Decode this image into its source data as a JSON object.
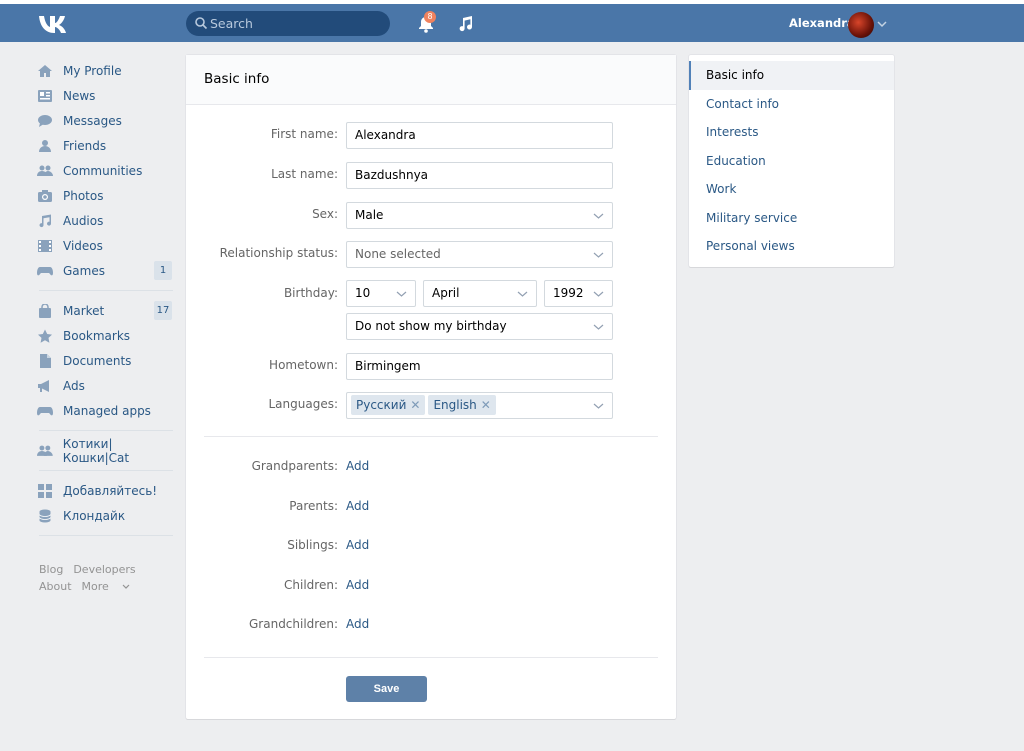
{
  "header": {
    "search_placeholder": "Search",
    "notifications_count": "8",
    "username": "Alexandra"
  },
  "nav": {
    "items": [
      {
        "label": "My Profile",
        "icon": "home-icon"
      },
      {
        "label": "News",
        "icon": "news-icon"
      },
      {
        "label": "Messages",
        "icon": "messages-icon"
      },
      {
        "label": "Friends",
        "icon": "friends-icon"
      },
      {
        "label": "Communities",
        "icon": "communities-icon"
      },
      {
        "label": "Photos",
        "icon": "camera-icon"
      },
      {
        "label": "Audios",
        "icon": "music-icon"
      },
      {
        "label": "Videos",
        "icon": "film-icon"
      },
      {
        "label": "Games",
        "icon": "gamepad-icon",
        "count": "1"
      }
    ],
    "items2": [
      {
        "label": "Market",
        "icon": "bag-icon",
        "count": "17"
      },
      {
        "label": "Bookmarks",
        "icon": "star-icon"
      },
      {
        "label": "Documents",
        "icon": "document-icon"
      },
      {
        "label": "Ads",
        "icon": "megaphone-icon"
      },
      {
        "label": "Managed apps",
        "icon": "gamepad-icon"
      }
    ],
    "items3": [
      {
        "label": "Котики|Кошки|Cat",
        "icon": "group-icon"
      }
    ],
    "items4": [
      {
        "label": "Добавляйтесь!",
        "icon": "grid-icon"
      },
      {
        "label": "Клондайк",
        "icon": "database-icon"
      }
    ],
    "footer": {
      "blog": "Blog",
      "developers": "Developers",
      "about": "About",
      "more": "More"
    }
  },
  "card": {
    "title": "Basic info",
    "first_name_label": "First name:",
    "first_name_value": "Alexandra",
    "last_name_label": "Last name:",
    "last_name_value": "Bazdushnya",
    "sex_label": "Sex:",
    "sex_value": "Male",
    "relationship_label": "Relationship status:",
    "relationship_value": "None selected",
    "birthday_label": "Birthday:",
    "birthday_day": "10",
    "birthday_month": "April",
    "birthday_year": "1992",
    "birthday_visibility": "Do not show my birthday",
    "hometown_label": "Hometown:",
    "hometown_value": "Birmingem",
    "languages_label": "Languages:",
    "languages": [
      "Русский",
      "English"
    ],
    "relatives": [
      {
        "label": "Grandparents:",
        "action": "Add"
      },
      {
        "label": "Parents:",
        "action": "Add"
      },
      {
        "label": "Siblings:",
        "action": "Add"
      },
      {
        "label": "Children:",
        "action": "Add"
      },
      {
        "label": "Grandchildren:",
        "action": "Add"
      }
    ],
    "save_label": "Save"
  },
  "right_menu": {
    "items": [
      "Basic info",
      "Contact info",
      "Interests",
      "Education",
      "Work",
      "Military service",
      "Personal views"
    ],
    "active": "Basic info"
  },
  "colors": {
    "header_bg": "#4a76a8",
    "link": "#2a5885",
    "save_button": "#5e81a8",
    "badge": "#f0825e"
  }
}
